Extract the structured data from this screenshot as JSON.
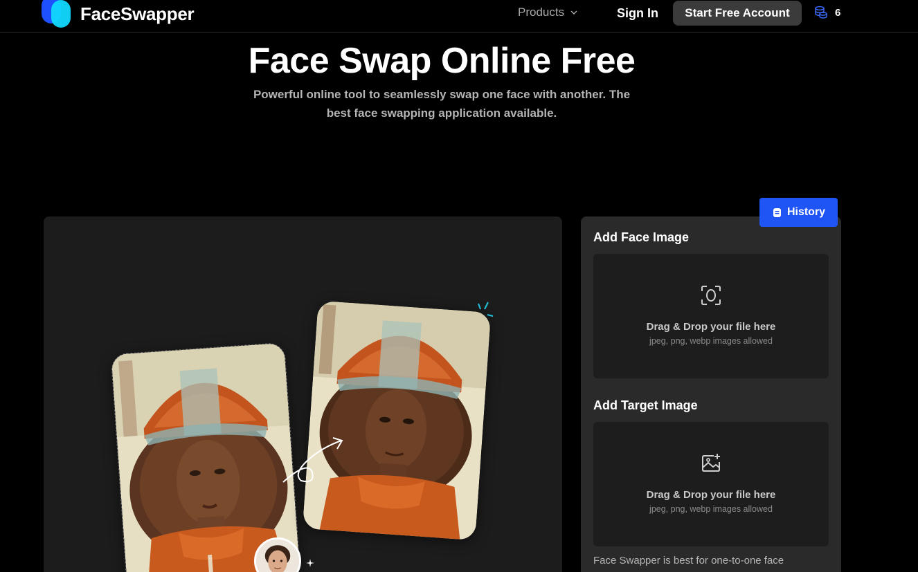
{
  "brand": {
    "name": "FaceSwapper"
  },
  "nav": {
    "products_label": "Products",
    "signin_label": "Sign In",
    "start_label": "Start Free Account",
    "credits_count": "6"
  },
  "hero": {
    "title": "Face Swap Online Free",
    "subtitle": "Powerful online tool to seamlessly swap one face with another. The best face swapping application available."
  },
  "panel": {
    "history_label": "History",
    "face": {
      "title": "Add Face Image",
      "drop_text": "Drag & Drop your file here",
      "hint": "jpeg, png, webp images allowed"
    },
    "target": {
      "title": "Add Target Image",
      "drop_text": "Drag & Drop your file here",
      "hint": "jpeg, png, webp images allowed"
    },
    "note": "Face Swapper is best for one-to-one face"
  },
  "colors": {
    "accent_blue": "#1f54f5",
    "logo_blue": "#1f50ff",
    "logo_cyan": "#11d8ff",
    "helmet_orange": "#c4541e"
  }
}
